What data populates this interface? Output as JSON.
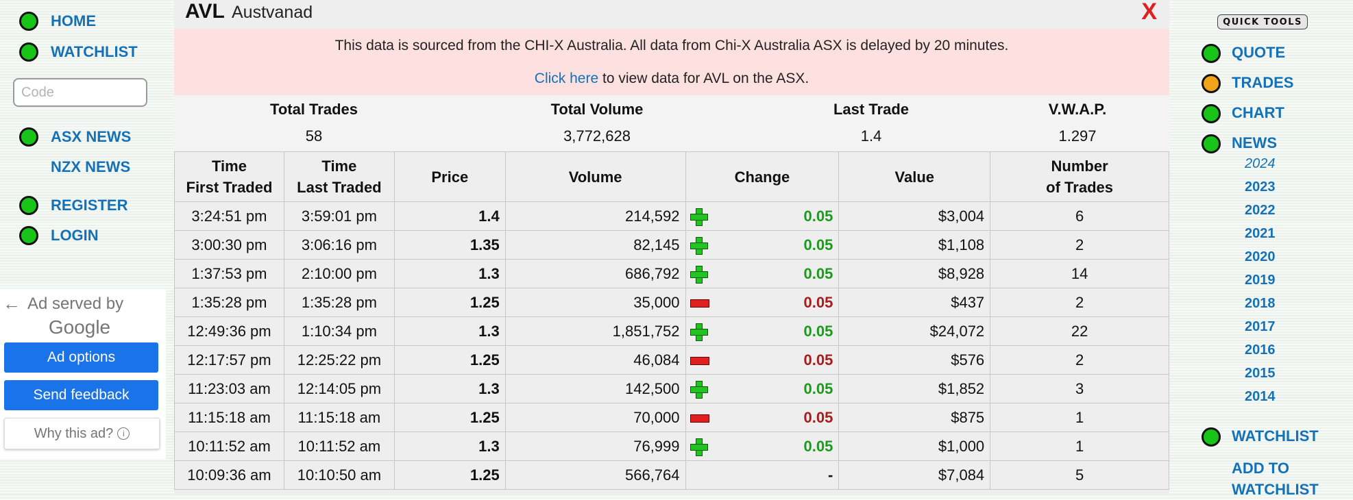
{
  "left_nav": {
    "home": "HOME",
    "watchlist": "WATCHLIST",
    "code_placeholder": "Code",
    "asx_news": "ASX NEWS",
    "nzx_news": "NZX NEWS",
    "register": "REGISTER",
    "login": "LOGIN"
  },
  "ad": {
    "served_by": "Ad served by",
    "google": "Google",
    "options": "Ad options",
    "feedback": "Send feedback",
    "why": "Why this ad?"
  },
  "header": {
    "code": "AVL",
    "name": "Austvanad",
    "close": "X"
  },
  "notice": {
    "line1": "This data is sourced from the CHI-X Australia. All data from Chi-X Australia ASX is delayed by 20 minutes.",
    "link": "Click here",
    "line2_rest": " to view data for AVL on the ASX."
  },
  "summary": {
    "total_trades_label": "Total Trades",
    "total_trades": "58",
    "total_volume_label": "Total Volume",
    "total_volume": "3,772,628",
    "last_trade_label": "Last Trade",
    "last_trade": "1.4",
    "vwap_label": "V.W.A.P.",
    "vwap": "1.297"
  },
  "table": {
    "headers": {
      "first_a": "Time",
      "first_b": "First Traded",
      "last_a": "Time",
      "last_b": "Last Traded",
      "price": "Price",
      "volume": "Volume",
      "change": "Change",
      "value": "Value",
      "trades_a": "Number",
      "trades_b": "of Trades"
    },
    "rows": [
      {
        "first": "3:24:51 pm",
        "last": "3:59:01 pm",
        "price": "1.4",
        "volume": "214,592",
        "dir": "up",
        "change": "0.05",
        "value": "$3,004",
        "trades": "6"
      },
      {
        "first": "3:00:30 pm",
        "last": "3:06:16 pm",
        "price": "1.35",
        "volume": "82,145",
        "dir": "up",
        "change": "0.05",
        "value": "$1,108",
        "trades": "2"
      },
      {
        "first": "1:37:53 pm",
        "last": "2:10:00 pm",
        "price": "1.3",
        "volume": "686,792",
        "dir": "up",
        "change": "0.05",
        "value": "$8,928",
        "trades": "14"
      },
      {
        "first": "1:35:28 pm",
        "last": "1:35:28 pm",
        "price": "1.25",
        "volume": "35,000",
        "dir": "down",
        "change": "0.05",
        "value": "$437",
        "trades": "2"
      },
      {
        "first": "12:49:36 pm",
        "last": "1:10:34 pm",
        "price": "1.3",
        "volume": "1,851,752",
        "dir": "up",
        "change": "0.05",
        "value": "$24,072",
        "trades": "22"
      },
      {
        "first": "12:17:57 pm",
        "last": "12:25:22 pm",
        "price": "1.25",
        "volume": "46,084",
        "dir": "down",
        "change": "0.05",
        "value": "$576",
        "trades": "2"
      },
      {
        "first": "11:23:03 am",
        "last": "12:14:05 pm",
        "price": "1.3",
        "volume": "142,500",
        "dir": "up",
        "change": "0.05",
        "value": "$1,852",
        "trades": "3"
      },
      {
        "first": "11:15:18 am",
        "last": "11:15:18 am",
        "price": "1.25",
        "volume": "70,000",
        "dir": "down",
        "change": "0.05",
        "value": "$875",
        "trades": "1"
      },
      {
        "first": "10:11:52 am",
        "last": "10:11:52 am",
        "price": "1.3",
        "volume": "76,999",
        "dir": "up",
        "change": "0.05",
        "value": "$1,000",
        "trades": "1"
      },
      {
        "first": "10:09:36 am",
        "last": "10:10:50 am",
        "price": "1.25",
        "volume": "566,764",
        "dir": "none",
        "change": "-",
        "value": "$7,084",
        "trades": "5"
      }
    ]
  },
  "right_nav": {
    "quick_tools": "QUICK TOOLS",
    "quote": "QUOTE",
    "trades": "TRADES",
    "chart": "CHART",
    "news": "NEWS",
    "years": [
      "2024",
      "2023",
      "2022",
      "2021",
      "2020",
      "2019",
      "2018",
      "2017",
      "2016",
      "2015",
      "2014"
    ],
    "watchlist": "WATCHLIST",
    "add_to_a": "ADD TO",
    "add_to_b": "WATCHLIST"
  },
  "colors": {
    "link": "#1471b8",
    "up": "#1b9a1b",
    "down": "#a81c1c",
    "notice_bg": "#fde0e0",
    "dot_green": "#19c419",
    "dot_orange": "#f2a319"
  }
}
